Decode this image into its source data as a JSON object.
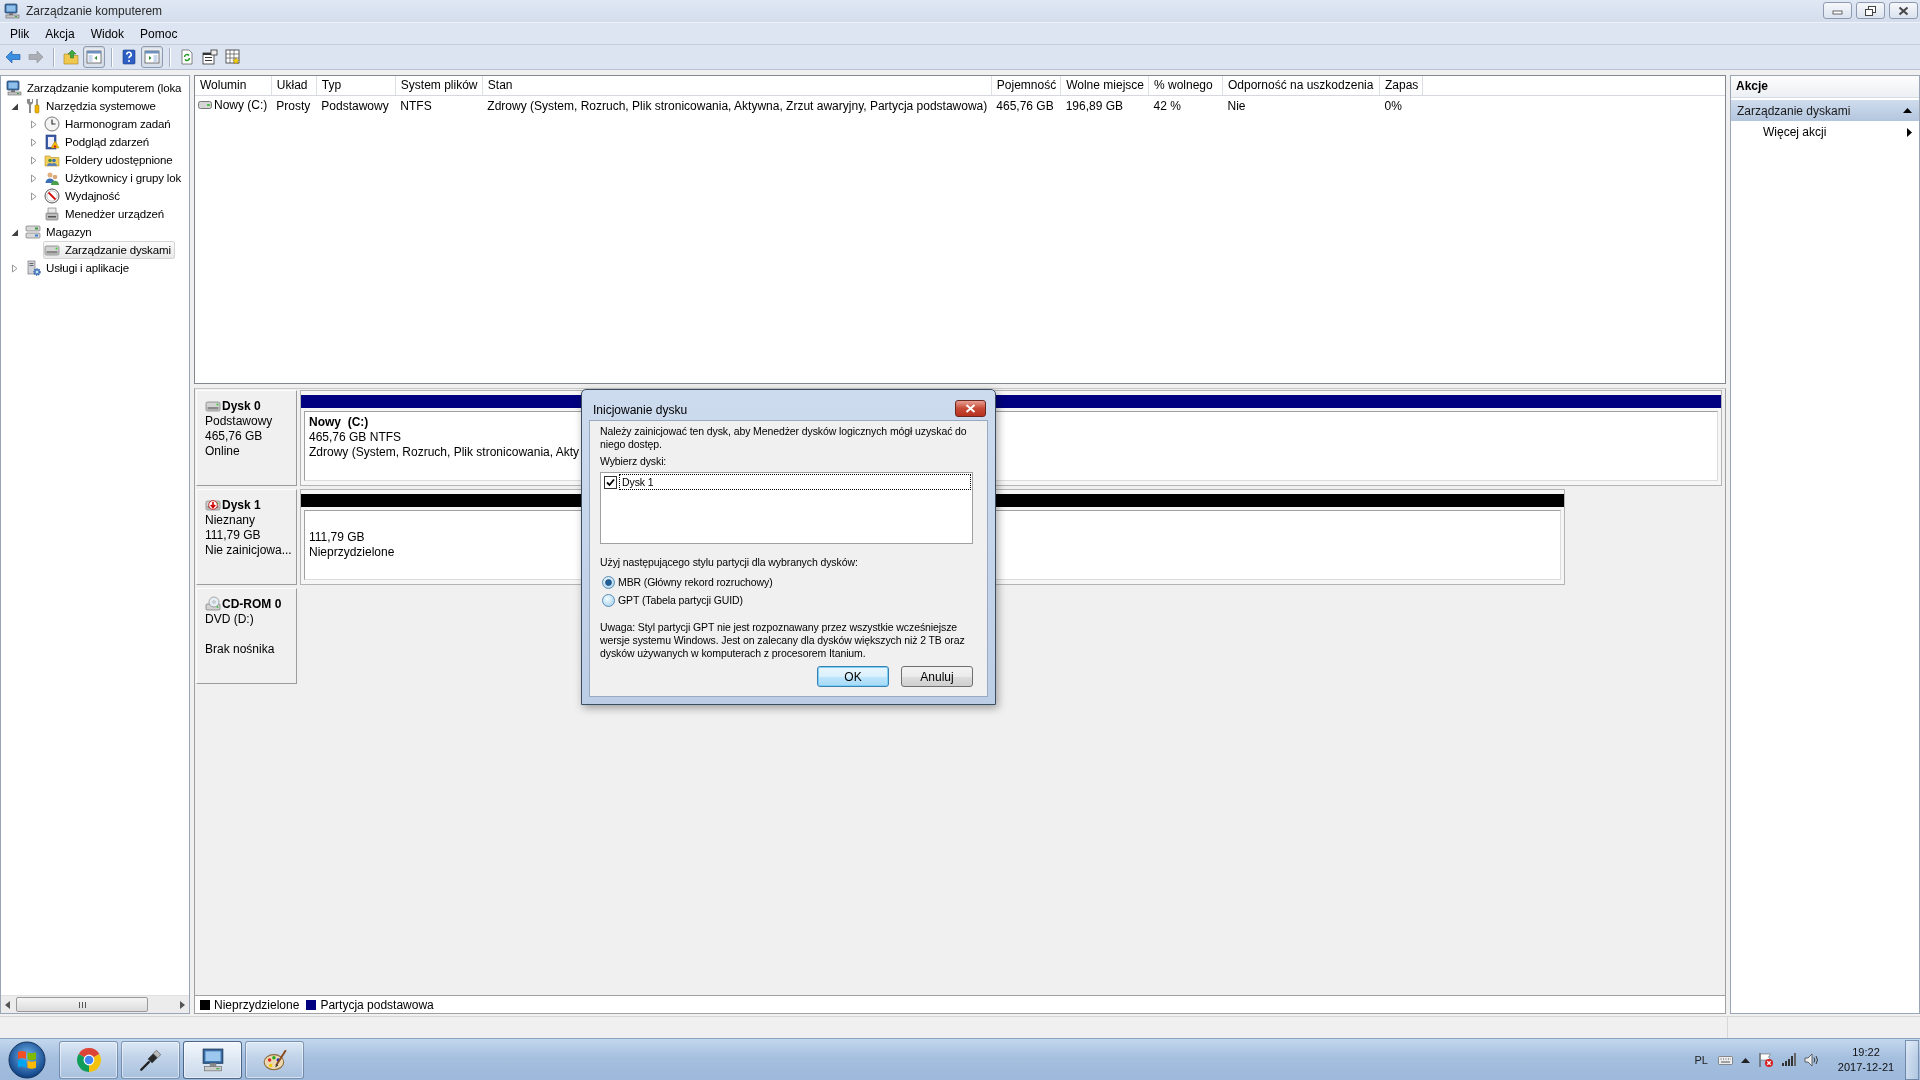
{
  "window": {
    "title": "Zarządzanie komputerem"
  },
  "menu": [
    "Plik",
    "Akcja",
    "Widok",
    "Pomoc"
  ],
  "toolbar": [
    [
      {
        "disabled": false,
        "pressed": false
      },
      {
        "disabled": true,
        "pressed": false
      }
    ],
    [
      {
        "disabled": false,
        "pressed": false
      },
      {
        "disabled": false,
        "pressed": true
      }
    ],
    [
      {
        "disabled": false,
        "pressed": false
      },
      {
        "disabled": false,
        "pressed": true
      }
    ],
    [
      {
        "disabled": false,
        "pressed": false
      },
      {
        "disabled": false,
        "pressed": false
      },
      {
        "disabled": false,
        "pressed": false
      }
    ]
  ],
  "tree": [
    {
      "label": "Zarządzanie komputerem (loka",
      "selected": false,
      "children": [
        {
          "label": "Narzędzia systemowe",
          "expanded": true,
          "selected": false,
          "children": [
            {
              "label": "Harmonogram zadań",
              "expanded": false,
              "selected": false
            },
            {
              "label": "Podgląd zdarzeń",
              "expanded": false,
              "selected": false
            },
            {
              "label": "Foldery udostępnione",
              "expanded": false,
              "selected": false
            },
            {
              "label": "Użytkownicy i grupy lok",
              "expanded": false,
              "selected": false
            },
            {
              "label": "Wydajność",
              "expanded": false,
              "selected": false
            },
            {
              "label": "Menedżer urządzeń",
              "selected": false
            }
          ]
        },
        {
          "label": "Magazyn",
          "expanded": true,
          "selected": false,
          "children": [
            {
              "label": "Zarządzanie dyskami",
              "selected": true
            }
          ]
        },
        {
          "label": "Usługi i aplikacje",
          "expanded": false,
          "selected": false
        }
      ]
    }
  ],
  "volumes": {
    "columns": [
      "Wolumin",
      "Układ",
      "Typ",
      "System plików",
      "Stan",
      "Pojemność",
      "Wolne miejsce",
      "% wolnego",
      "Odporność na uszkodzenia",
      "Zapas"
    ],
    "rows": [
      {
        "selected": false,
        "cells": [
          "Nowy (C:)",
          "Prosty",
          "Podstawowy",
          "NTFS",
          "Zdrowy (System, Rozruch, Plik stronicowania, Aktywna, Zrzut awaryjny, Partycja podstawowa)",
          "465,76 GB",
          "196,89 GB",
          "42 %",
          "Nie",
          "0%"
        ]
      }
    ]
  },
  "disk_map": {
    "disks": [
      {
        "kind": "basic",
        "name": "Dysk 0",
        "type": "Podstawowy",
        "size": "465,76 GB",
        "status": "Online",
        "partitions": [
          {
            "kind": "primary",
            "title": "Nowy  (C:)",
            "size": "465,76 GB NTFS",
            "status": "Zdrowy (System, Rozruch, Plik stronicowania, Akty"
          }
        ]
      },
      {
        "kind": "unknown",
        "name": "Dysk 1",
        "type": "Nieznany",
        "size": "111,79 GB",
        "status": "Nie zainicjowa...",
        "partitions": [
          {
            "kind": "unallocated",
            "size": "111,79 GB",
            "status": "Nieprzydzielone"
          }
        ]
      },
      {
        "kind": "cdrom",
        "name": "CD-ROM 0",
        "type": "DVD (D:)",
        "status": "Brak nośnika"
      }
    ],
    "legend": [
      {
        "label": "Nieprzydzielone",
        "color": "#000000"
      },
      {
        "label": "Partycja podstawowa",
        "color": "#000080"
      }
    ]
  },
  "actions": {
    "title": "Akcje",
    "groups": [
      {
        "title": "Zarządzanie dyskami",
        "expanded": true,
        "items": [
          {
            "label": "Więcej akcji",
            "submenu": true
          }
        ]
      }
    ]
  },
  "dialog": {
    "title": "Inicjowanie dysku",
    "message": "Należy zainicjować ten dysk, aby Menedżer dysków logicznych mógł uzyskać do niego dostęp.",
    "disks_label": "Wybierz dyski:",
    "disks": [
      {
        "label": "Dysk 1",
        "checked": true,
        "focused": true
      }
    ],
    "style_label": "Użyj następującego stylu partycji dla wybranych dysków:",
    "styles": [
      {
        "label": "MBR (Główny rekord rozruchowy)",
        "selected": true
      },
      {
        "label": "GPT (Tabela partycji GUID)",
        "selected": false
      }
    ],
    "note": "Uwaga: Styl partycji GPT nie jest rozpoznawany przez wszystkie wcześniejsze wersje systemu Windows. Jest on zalecany dla dysków większych niż 2 TB oraz dysków używanych w komputerach z procesorem Itanium.",
    "buttons": [
      {
        "label": "OK",
        "default": true
      },
      {
        "label": "Anuluj",
        "default": false
      }
    ]
  },
  "taskbar": {
    "apps": [
      {
        "active": false
      },
      {
        "active": false
      },
      {
        "active": true
      },
      {
        "active": false
      }
    ],
    "language": "PL",
    "clock": {
      "time": "19:22",
      "date": "2017-12-21"
    }
  }
}
